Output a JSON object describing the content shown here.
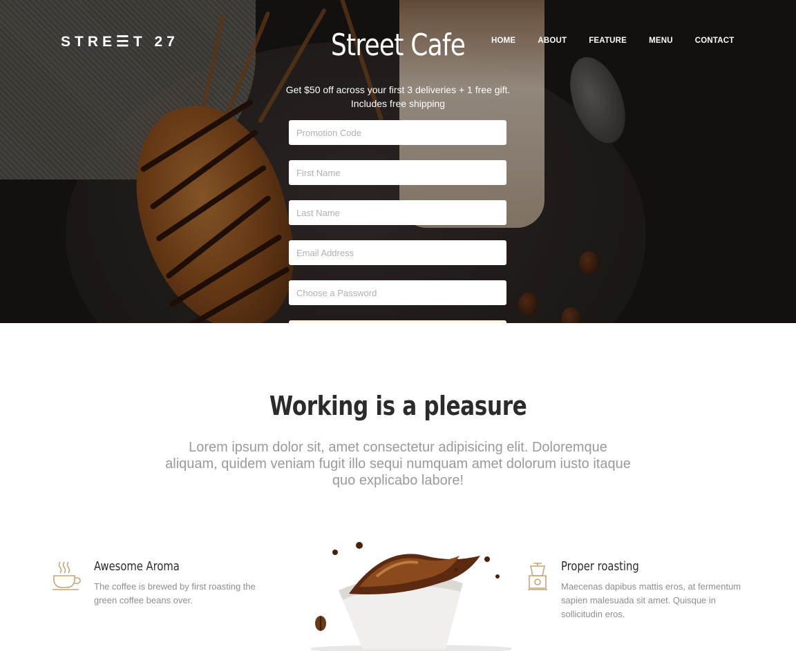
{
  "header": {
    "logo": "STRE☰T 27",
    "title": "Street Cafe",
    "nav": [
      "HOME",
      "ABOUT",
      "FEATURE",
      "MENU",
      "CONTACT"
    ]
  },
  "promo": {
    "line1": "Get $50 off across your first 3 deliveries + 1 free gift.",
    "line2": "Includes free shipping"
  },
  "form": {
    "promotion_code": "Promotion Code",
    "first_name": "First Name",
    "last_name": "Last Name",
    "email": "Email Address",
    "password": "Choose a Password"
  },
  "section": {
    "title": "Working is a pleasure",
    "text": "Lorem ipsum dolor sit, amet consectetur adipisicing elit. Doloremque aliquam, quidem veniam fugit illo sequi numquam amet dolorum iusto itaque quo explicabo labore!"
  },
  "features": [
    {
      "title": "Awesome Aroma",
      "text": "The coffee is brewed by first roasting the green coffee beans over.",
      "icon": "coffee-cup-icon"
    },
    {
      "title": "Proper roasting",
      "text": "Maecenas dapibus mattis eros, at fermentum sapien malesuada sit amet. Quisque in sollicitudin eros.",
      "icon": "coffee-grinder-icon"
    }
  ],
  "colors": {
    "accent": "#c8a27a",
    "heading": "#2b2b2b",
    "muted": "#9a9a9a"
  }
}
